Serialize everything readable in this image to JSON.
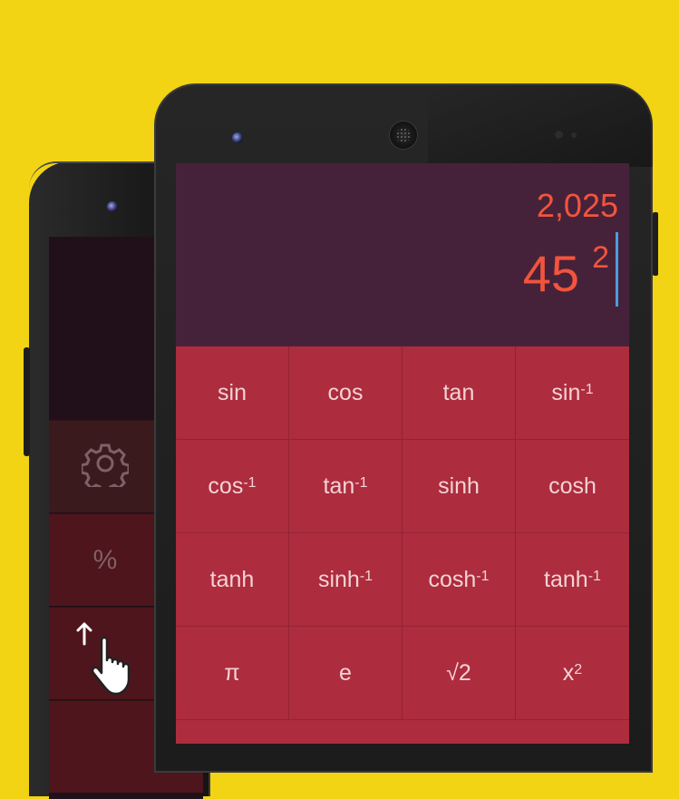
{
  "calculator": {
    "result": "2,025",
    "expression": {
      "base": "45",
      "exponent": "2"
    }
  },
  "keypad": [
    {
      "label": "sin",
      "sup": ""
    },
    {
      "label": "cos",
      "sup": ""
    },
    {
      "label": "tan",
      "sup": ""
    },
    {
      "label": "sin",
      "sup": "-1"
    },
    {
      "label": "cos",
      "sup": "-1"
    },
    {
      "label": "tan",
      "sup": "-1"
    },
    {
      "label": "sinh",
      "sup": ""
    },
    {
      "label": "cosh",
      "sup": ""
    },
    {
      "label": "tanh",
      "sup": ""
    },
    {
      "label": "sinh",
      "sup": "-1"
    },
    {
      "label": "cosh",
      "sup": "-1"
    },
    {
      "label": "tanh",
      "sup": "-1"
    },
    {
      "label": "π",
      "sup": ""
    },
    {
      "label": "e",
      "sup": ""
    },
    {
      "label": "√2",
      "sup": ""
    },
    {
      "label": "x",
      "sup": "2"
    }
  ],
  "side_panel": {
    "settings_icon": "gear-icon",
    "percent_label": "%",
    "swipe_icon": "swipe-up-hand-icon"
  },
  "colors": {
    "background": "#f3d414",
    "display_bg": "#45223a",
    "keypad_bg": "#ad2c3d",
    "accent_text": "#f2543d",
    "cursor": "#4a9ee2"
  }
}
